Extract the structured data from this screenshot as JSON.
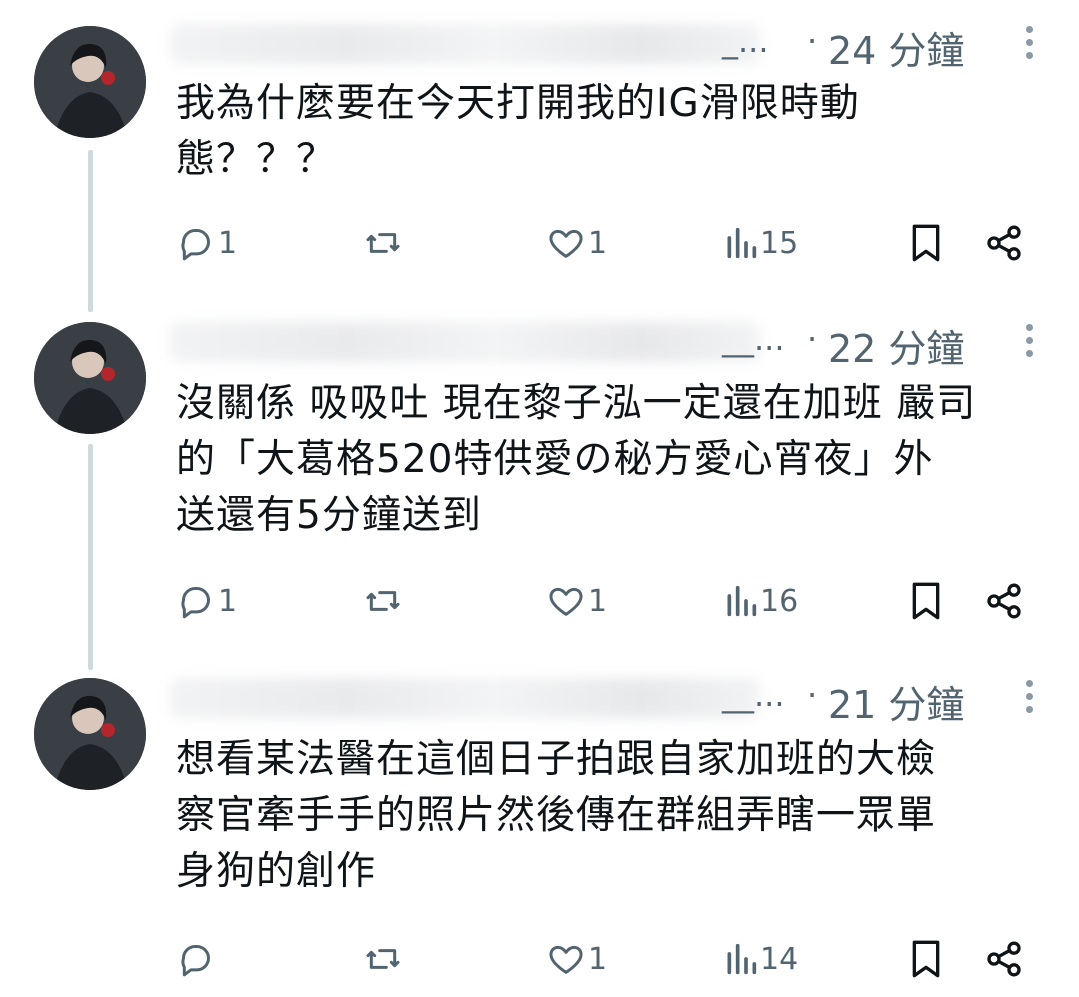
{
  "tweets": [
    {
      "handle_tail": "_...",
      "time": "24 分鐘",
      "lines": [
        "我為什麼要在今天打開我的IG滑限時動",
        "態？？？"
      ],
      "actions": {
        "reply": "1",
        "retweet": "",
        "like": "1",
        "views": "15"
      }
    },
    {
      "handle_tail": "__...",
      "time": "22 分鐘",
      "lines": [
        "沒關係 吸吸吐 現在黎子泓一定還在加班 嚴司",
        "的「大葛格520特供愛の秘方愛心宵夜」外",
        "送還有5分鐘送到"
      ],
      "actions": {
        "reply": "1",
        "retweet": "",
        "like": "1",
        "views": "16"
      }
    },
    {
      "handle_tail": "__...",
      "time": "21 分鐘",
      "lines": [
        "想看某法醫在這個日子拍跟自家加班的大檢",
        "察官牽手手的照片然後傳在群組弄瞎一眾單",
        "身狗的創作"
      ],
      "actions": {
        "reply": "",
        "retweet": "",
        "like": "1",
        "views": "14"
      }
    }
  ],
  "colors": {
    "text": "#0f1419",
    "secondary": "#536471",
    "thread": "#cfd9de"
  },
  "icons": [
    "reply-icon",
    "retweet-icon",
    "like-icon",
    "views-icon",
    "bookmark-icon",
    "share-icon",
    "more-icon"
  ]
}
